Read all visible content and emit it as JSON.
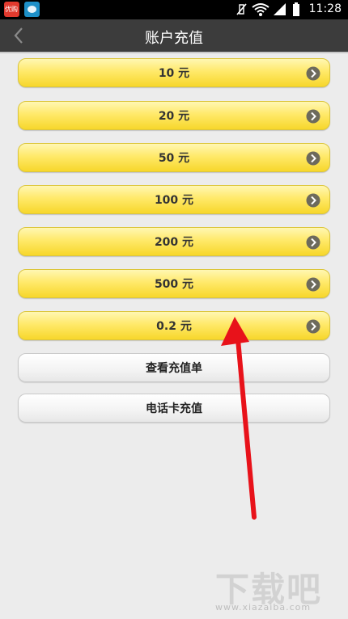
{
  "status_bar": {
    "app1_label": "优购",
    "time": "11:28"
  },
  "header": {
    "title": "账户充值"
  },
  "recharge_options": [
    {
      "label": "10 元"
    },
    {
      "label": "20 元"
    },
    {
      "label": "50 元"
    },
    {
      "label": "100 元"
    },
    {
      "label": "200 元"
    },
    {
      "label": "500 元"
    },
    {
      "label": "0.2 元"
    }
  ],
  "actions": {
    "view_orders_label": "查看充值单",
    "phone_card_label": "电话卡充值"
  },
  "watermark": {
    "logo_text": "下载吧",
    "url_text": "www.xiazaiba.com"
  },
  "colors": {
    "button_yellow": "#ffe96a",
    "arrow_red": "#e8121a",
    "titlebar": "#3c3c3c"
  },
  "icons": [
    "back-icon",
    "chevron-right-icon",
    "wifi-icon",
    "signal-icon",
    "battery-icon",
    "silent-icon"
  ]
}
